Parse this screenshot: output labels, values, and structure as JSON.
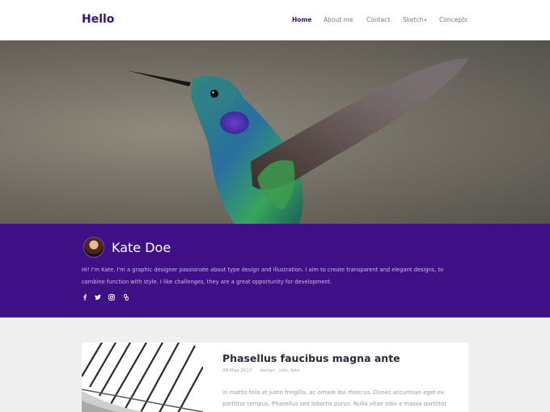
{
  "header": {
    "brand": "Hello",
    "nav": [
      {
        "label": "Home",
        "active": true
      },
      {
        "label": "About me",
        "active": false
      },
      {
        "label": "Contact",
        "active": false
      },
      {
        "label": "Sketch",
        "active": false,
        "dropdown": true
      },
      {
        "label": "Concepts",
        "active": false
      }
    ]
  },
  "hero": {
    "image": "hummingbird-photo"
  },
  "profile": {
    "name": "Kate Doe",
    "bio": "Hi! I'm Kate. I'm a graphic designer passionate about type design and illustration. I aim to create transparent and elegant designs, to combine function with style. I like challenges, they are a great opportunity for development.",
    "socials": [
      "facebook-icon",
      "twitter-icon",
      "instagram-icon",
      "link-icon"
    ]
  },
  "post": {
    "title": "Phasellus faucibus magna ante",
    "date": "28 May 2017",
    "tags": "design , info, felis",
    "excerpt": "In mattis felis et justo fringilla, ac ornare dui rhoncus. Donec accumsan eget ex porttitor tempus. Phasellus sed lobortis purus. Nulla vitae odio a massa porttitor pulvinar."
  },
  "colors": {
    "primary": "#3f0f86",
    "brand": "#3b0f7a",
    "background": "#efefef"
  }
}
